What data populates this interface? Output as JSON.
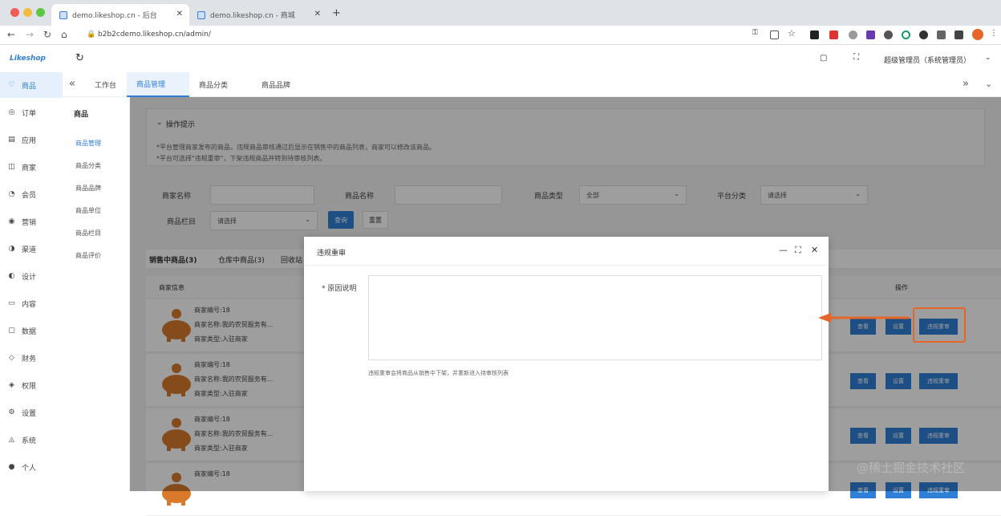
{
  "browser": {
    "tabs": [
      {
        "label": "demo.likeshop.cn - 后台",
        "active": true
      },
      {
        "label": "demo.likeshop.cn - 商城",
        "active": false
      }
    ],
    "url": "b2b2cdemo.likeshop.cn/admin/"
  },
  "app": {
    "logo": "Likeshop",
    "user": "超级管理员（系统管理员）"
  },
  "sidebar": {
    "items": [
      {
        "label": "商品",
        "icon": "goods-icon",
        "active": true
      },
      {
        "label": "订单",
        "icon": "order-icon"
      },
      {
        "label": "应用",
        "icon": "app-icon"
      },
      {
        "label": "商家",
        "icon": "shop-icon"
      },
      {
        "label": "会员",
        "icon": "member-icon"
      },
      {
        "label": "营销",
        "icon": "marketing-icon"
      },
      {
        "label": "渠道",
        "icon": "channel-icon"
      },
      {
        "label": "设计",
        "icon": "design-icon"
      },
      {
        "label": "内容",
        "icon": "content-icon"
      },
      {
        "label": "数据",
        "icon": "data-icon"
      },
      {
        "label": "财务",
        "icon": "finance-icon"
      },
      {
        "label": "权限",
        "icon": "permission-icon"
      },
      {
        "label": "设置",
        "icon": "settings-icon"
      },
      {
        "label": "系统",
        "icon": "system-icon"
      },
      {
        "label": "个人",
        "icon": "person-icon"
      }
    ]
  },
  "submenu": {
    "title": "商品",
    "items": [
      {
        "label": "商品管理",
        "active": true
      },
      {
        "label": "商品分类"
      },
      {
        "label": "商品品牌"
      },
      {
        "label": "商品单位"
      },
      {
        "label": "商品栏目"
      },
      {
        "label": "商品评价"
      }
    ]
  },
  "page_tabs": [
    {
      "label": "工作台"
    },
    {
      "label": "商品管理",
      "active": true
    },
    {
      "label": "商品分类"
    },
    {
      "label": "商品品牌"
    }
  ],
  "tips": {
    "title": "操作提示",
    "lines": [
      "*平台管理商家发布的商品，违规商品审核通过后显示在销售中的商品列表，商家可以修改该商品。",
      "*平台可选择\"违规重审\"，下架违规商品并转到待审核列表。"
    ]
  },
  "filters": {
    "shop_name": {
      "label": "商家名称",
      "value": ""
    },
    "goods_name": {
      "label": "商品名称",
      "value": ""
    },
    "goods_type": {
      "label": "商品类型",
      "value": "全部"
    },
    "platform_category": {
      "label": "平台分类",
      "value": "请选择"
    },
    "goods_column": {
      "label": "商品栏目",
      "value": "请选择"
    },
    "query_label": "查询",
    "reset_label": "重置"
  },
  "list_tabs": [
    "销售中商品(3)",
    "仓库中商品(3)",
    "回收站"
  ],
  "table": {
    "col_shop": "商家信息",
    "col_action": "操作",
    "rows": [
      {
        "shop_no": "商家编号:18",
        "shop_name": "商家名称:我的农贸服务有...",
        "shop_type": "商家类型:入驻商家"
      },
      {
        "shop_no": "商家编号:18",
        "shop_name": "商家名称:我的农贸服务有...",
        "shop_type": "商家类型:入驻商家"
      },
      {
        "shop_no": "商家编号:18",
        "shop_name": "商家名称:我的农贸服务有...",
        "shop_type": "商家类型:入驻商家"
      },
      {
        "shop_no": "商家编号:18",
        "shop_name": "",
        "shop_type": ""
      }
    ],
    "btn_view": "查看",
    "btn_set": "设置",
    "btn_review": "违规重审"
  },
  "modal": {
    "title": "违规重审",
    "field_label": "原因说明",
    "value": "",
    "hint": "违规重审会将商品从销售中下架，并重新进入待审核列表"
  },
  "watermark": "@稀土掘金技术社区",
  "colors": {
    "accent": "#2f7fd6",
    "highlight": "#e8652a",
    "pig": "#d97a2a"
  }
}
